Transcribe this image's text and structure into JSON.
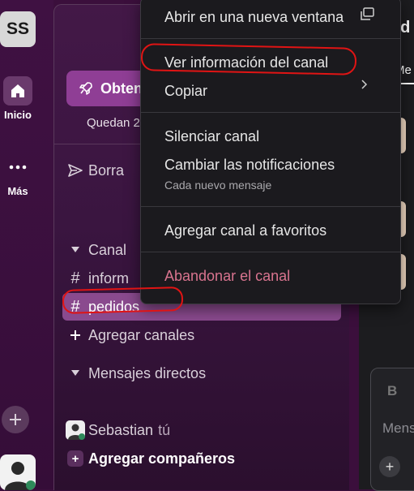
{
  "workspace": {
    "initials": "SS"
  },
  "rail": {
    "home_label": "Inicio",
    "more_label": "Más"
  },
  "sidebar": {
    "upgrade_label": "Obten",
    "trial_text": "Quedan 2",
    "drafts_label": "Borra",
    "channels_section": "Canal",
    "channels": [
      {
        "name": "inform"
      },
      {
        "name": "pedidos",
        "selected": true
      }
    ],
    "add_channels": "Agregar canales",
    "dms_section": "Mensajes directos",
    "dm_user": "Sebastian",
    "dm_user_suffix": "tú",
    "add_teammates": "Agregar compañeros"
  },
  "context_menu": {
    "open_new_window": "Abrir en una nueva ventana",
    "view_channel_info": "Ver información del canal",
    "copy": "Copiar",
    "mute_channel": "Silenciar canal",
    "change_notifications": "Cambiar las notificaciones",
    "notifications_value": "Cada nuevo mensaje",
    "add_to_favorites": "Agregar canal a favoritos",
    "leave_channel": "Abandonar el canal"
  },
  "main": {
    "title_partial": "ed",
    "tab_partial": "Me",
    "composer_bold": "B",
    "composer_placeholder": "Mens"
  },
  "colors": {
    "sidebar_bg": "#431847",
    "selected_row": "#8a4a8e",
    "danger_text": "#d9748f",
    "annotation": "#e01414"
  }
}
